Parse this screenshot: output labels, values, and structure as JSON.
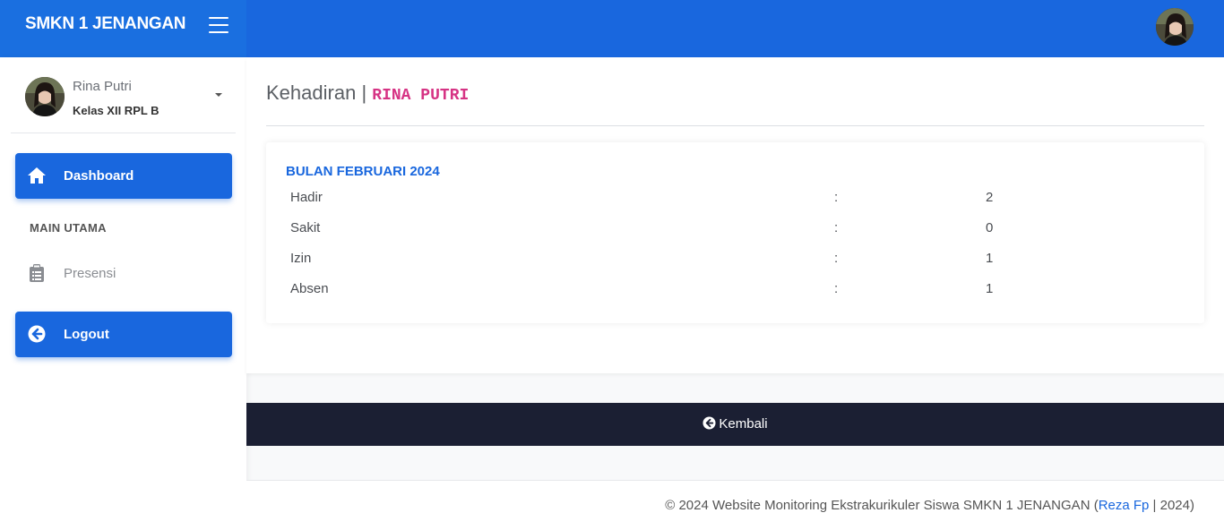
{
  "brand": {
    "title": "SMKN 1 JENANGAN"
  },
  "user": {
    "name": "Rina Putri",
    "class": "Kelas XII RPL B"
  },
  "sidebar": {
    "dashboard_label": "Dashboard",
    "section_title": "MAIN UTAMA",
    "presensi_label": "Presensi",
    "logout_label": "Logout"
  },
  "page": {
    "title": "Kehadiran",
    "separator": "|",
    "student": "RINA PUTRI"
  },
  "attendance": {
    "month_title": "BULAN FEBRUARI 2024",
    "rows": [
      {
        "label": "Hadir",
        "colon": ":",
        "value": "2"
      },
      {
        "label": "Sakit",
        "colon": ":",
        "value": "0"
      },
      {
        "label": "Izin",
        "colon": ":",
        "value": "1"
      },
      {
        "label": "Absen",
        "colon": ":",
        "value": "1"
      }
    ]
  },
  "back": {
    "label": "Kembali"
  },
  "footer": {
    "prefix": "© 2024 Website Monitoring Ekstrakurikuler Siswa SMKN 1 JENANGAN (",
    "author": "Reza Fp",
    "suffix": " | 2024)"
  },
  "colors": {
    "primary": "#1967de",
    "dark": "#1b1f33",
    "code": "#d63384"
  }
}
